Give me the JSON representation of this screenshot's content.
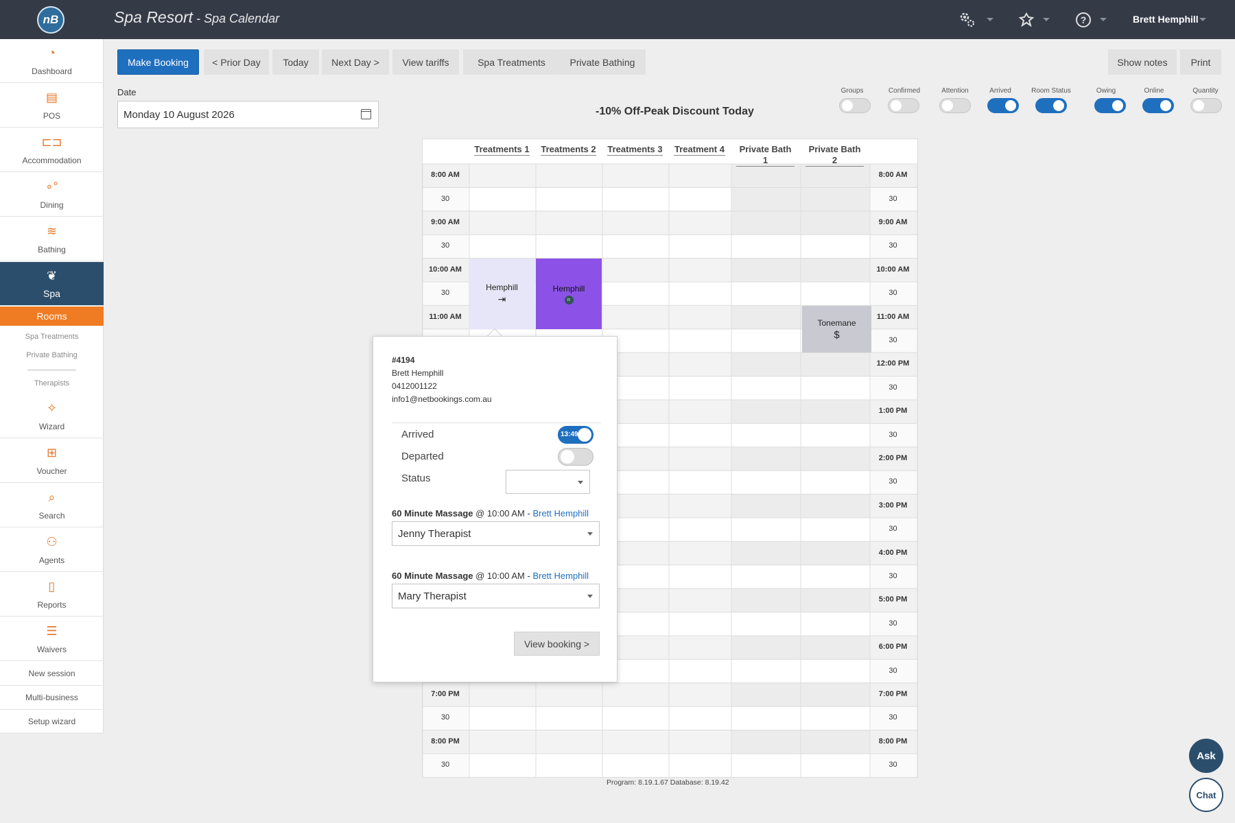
{
  "header": {
    "logo_text": "nB",
    "title": "Spa Resort",
    "separator": " - ",
    "subtitle": "Spa Calendar",
    "user": "Brett Hemphill"
  },
  "sidebar": {
    "items": [
      {
        "label": "Dashboard",
        "icon": "dashboard-icon"
      },
      {
        "label": "POS",
        "icon": "pos-icon"
      },
      {
        "label": "Accommodation",
        "icon": "bed-icon"
      },
      {
        "label": "Dining",
        "icon": "dining-icon"
      },
      {
        "label": "Bathing",
        "icon": "waves-icon"
      },
      {
        "label": "Spa",
        "icon": "lotus-icon"
      },
      {
        "label": "Wizard",
        "icon": "magic-wand-icon"
      },
      {
        "label": "Voucher",
        "icon": "gift-icon"
      },
      {
        "label": "Search",
        "icon": "search-icon"
      },
      {
        "label": "Agents",
        "icon": "agents-icon"
      },
      {
        "label": "Reports",
        "icon": "document-icon"
      },
      {
        "label": "Waivers",
        "icon": "checklist-icon"
      }
    ],
    "rooms_tab": "Rooms",
    "sub_links": [
      "Spa Treatments",
      "Private Bathing",
      "Therapists"
    ],
    "bottom_links": [
      "New session",
      "Multi-business",
      "Setup wizard"
    ]
  },
  "toolbar": {
    "make_booking": "Make Booking",
    "prior_day": "< Prior Day",
    "today": "Today",
    "next_day": "Next Day >",
    "view_tariffs": "View tariffs",
    "spa_treatments": "Spa Treatments",
    "private_bathing": "Private Bathing",
    "show_notes": "Show notes",
    "print": "Print"
  },
  "date": {
    "label": "Date",
    "value": "Monday 10 August 2026"
  },
  "discount": "-10% Off-Peak Discount Today",
  "toggles": [
    {
      "label": "Groups",
      "on": false
    },
    {
      "label": "Confirmed",
      "on": false
    },
    {
      "label": "Attention",
      "on": false
    },
    {
      "label": "Arrived",
      "on": true
    },
    {
      "label": "Room Status",
      "on": true
    },
    {
      "label": "Owing",
      "on": true
    },
    {
      "label": "Online",
      "on": true
    },
    {
      "label": "Quantity",
      "on": false
    }
  ],
  "calendar": {
    "columns": [
      "Treatments 1",
      "Treatments 2",
      "Treatments 3",
      "Treatment 4",
      "Private Bath 1",
      "Private Bath 2"
    ],
    "times": [
      "8:00 AM",
      "30",
      "9:00 AM",
      "30",
      "10:00 AM",
      "30",
      "11:00 AM",
      "30",
      "12:00 PM",
      "30",
      "1:00 PM",
      "30",
      "2:00 PM",
      "30",
      "3:00 PM",
      "30",
      "4:00 PM",
      "30",
      "5:00 PM",
      "30",
      "6:00 PM",
      "30",
      "7:00 PM",
      "30",
      "8:00 PM",
      "30"
    ],
    "bookings": [
      {
        "name": "Hemphill",
        "icon": "sign-in-icon",
        "column": "Treatments 1",
        "start": "10:00 AM",
        "slots": 3,
        "color": "#e6e6f8"
      },
      {
        "name": "Hemphill",
        "icon": "netbookings-icon",
        "column": "Treatments 2",
        "start": "10:00 AM",
        "slots": 3,
        "color": "#8c52e8"
      },
      {
        "name": "Tonemane",
        "icon": "$",
        "column": "Private Bath 2",
        "start": "11:00 AM",
        "slots": 2,
        "color": "#c9c9d2"
      }
    ]
  },
  "popup": {
    "booking_id": "#4194",
    "guest": "Brett Hemphill",
    "phone": "0412001122",
    "email": "info1@netbookings.com.au",
    "arrived_label": "Arrived",
    "arrived_time": "13:49",
    "departed_label": "Departed",
    "status_label": "Status",
    "status_value": "",
    "services": [
      {
        "name": "60 Minute Massage",
        "at": "@ 10:00 AM -",
        "guest": "Brett Hemphill",
        "therapist": "Jenny Therapist"
      },
      {
        "name": "60 Minute Massage",
        "at": "@ 10:00 AM -",
        "guest": "Brett Hemphill",
        "therapist": "Mary Therapist"
      }
    ],
    "view_booking": "View booking >"
  },
  "footer_version": "Program: 8.19.1.67 Database: 8.19.42",
  "ask": "Ask",
  "chat": "Chat",
  "colors": {
    "topbar": "#353a47",
    "accent_blue": "#1f6fbf",
    "sidebar_active": "#2b4e6c",
    "rooms_orange": "#ef7c22"
  }
}
